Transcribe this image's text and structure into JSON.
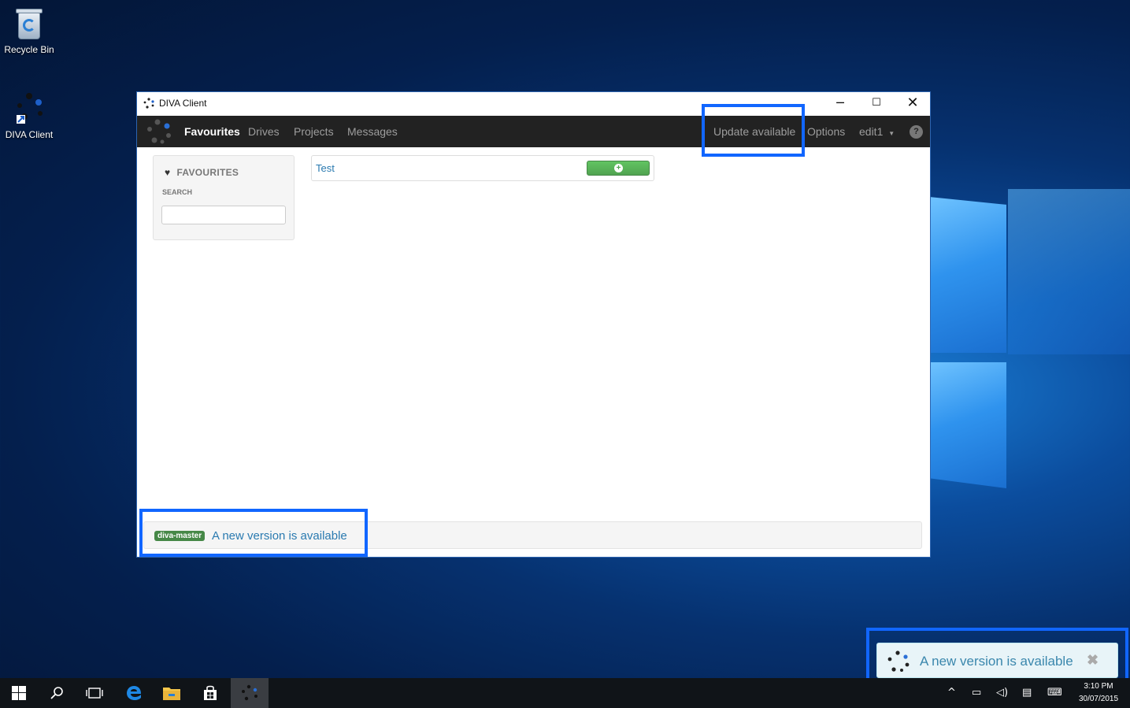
{
  "desktop": {
    "icons": [
      {
        "label": "Recycle Bin"
      },
      {
        "label": "DIVA Client"
      }
    ]
  },
  "window": {
    "title": "DIVA Client",
    "controls": {
      "minimize": "─",
      "maximize": "☐",
      "close": "✕"
    }
  },
  "navbar": {
    "items": [
      "Favourites",
      "Drives",
      "Projects",
      "Messages"
    ],
    "active": "Favourites",
    "right": {
      "update": "Update available",
      "options": "Options",
      "user": "edit1",
      "help": "?"
    }
  },
  "sidebar": {
    "heading": "FAVOURITES",
    "search_label": "SEARCH",
    "search_value": ""
  },
  "favourites": [
    {
      "name": "Test",
      "action_icon": "plus-circle-icon"
    }
  ],
  "footer": {
    "branch": "diva-master",
    "message": "A new version is available"
  },
  "toast": {
    "message": "A new version is available",
    "close": "✖"
  },
  "tray": {
    "time": "3:10 PM",
    "date": "30/07/2015"
  },
  "colors": {
    "highlight": "#1166ff",
    "navbar": "#222222",
    "link": "#2a7ab0",
    "success": "#51a351"
  }
}
